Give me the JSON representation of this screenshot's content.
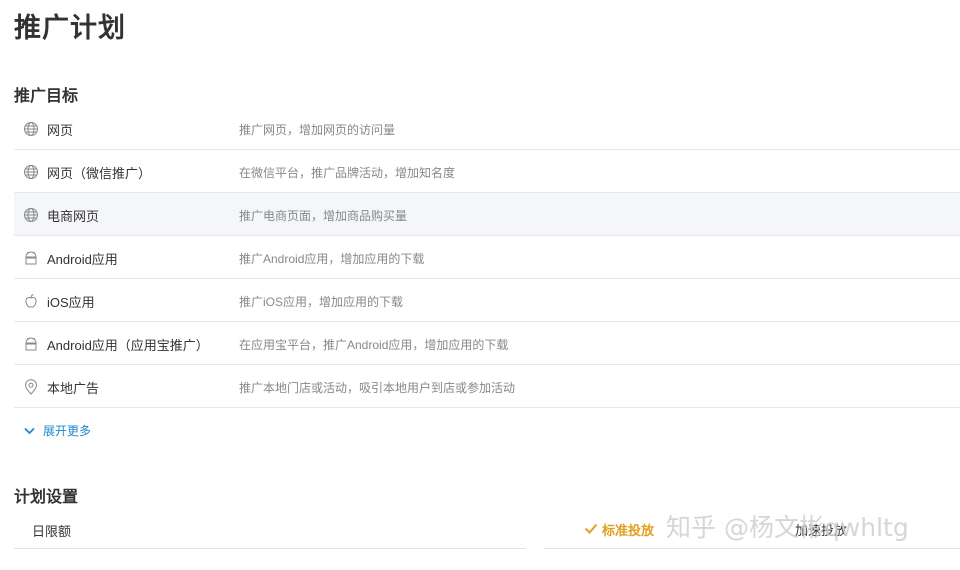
{
  "page": {
    "title": "推广计划"
  },
  "goal_section": {
    "title": "推广目标",
    "items": [
      {
        "name": "网页",
        "desc": "推广网页，增加网页的访问量",
        "icon": "globe-icon"
      },
      {
        "name": "网页（微信推广）",
        "desc": "在微信平台，推广品牌活动，增加知名度",
        "icon": "globe-icon"
      },
      {
        "name": "电商网页",
        "desc": "推广电商页面，增加商品购买量",
        "icon": "globe-icon",
        "highlighted": true
      },
      {
        "name": "Android应用",
        "desc": "推广Android应用，增加应用的下载",
        "icon": "android-icon"
      },
      {
        "name": "iOS应用",
        "desc": "推广iOS应用，增加应用的下载",
        "icon": "apple-icon"
      },
      {
        "name": "Android应用（应用宝推广）",
        "desc": "在应用宝平台，推广Android应用，增加应用的下载",
        "icon": "android-icon"
      },
      {
        "name": "本地广告",
        "desc": "推广本地门店或活动，吸引本地用户到店或参加活动",
        "icon": "location-pin-icon"
      }
    ],
    "expand_label": "展开更多"
  },
  "plan_section": {
    "title": "计划设置",
    "daily_budget_label": "日限额",
    "standard_delivery_label": "标准投放",
    "accelerated_delivery_label": "加速投放"
  },
  "watermark": {
    "text": "知乎 @杨文彬qwhltg"
  },
  "colors": {
    "link": "#1e88d0",
    "selected": "#e0a020",
    "row_highlight": "#f4f6f9"
  }
}
